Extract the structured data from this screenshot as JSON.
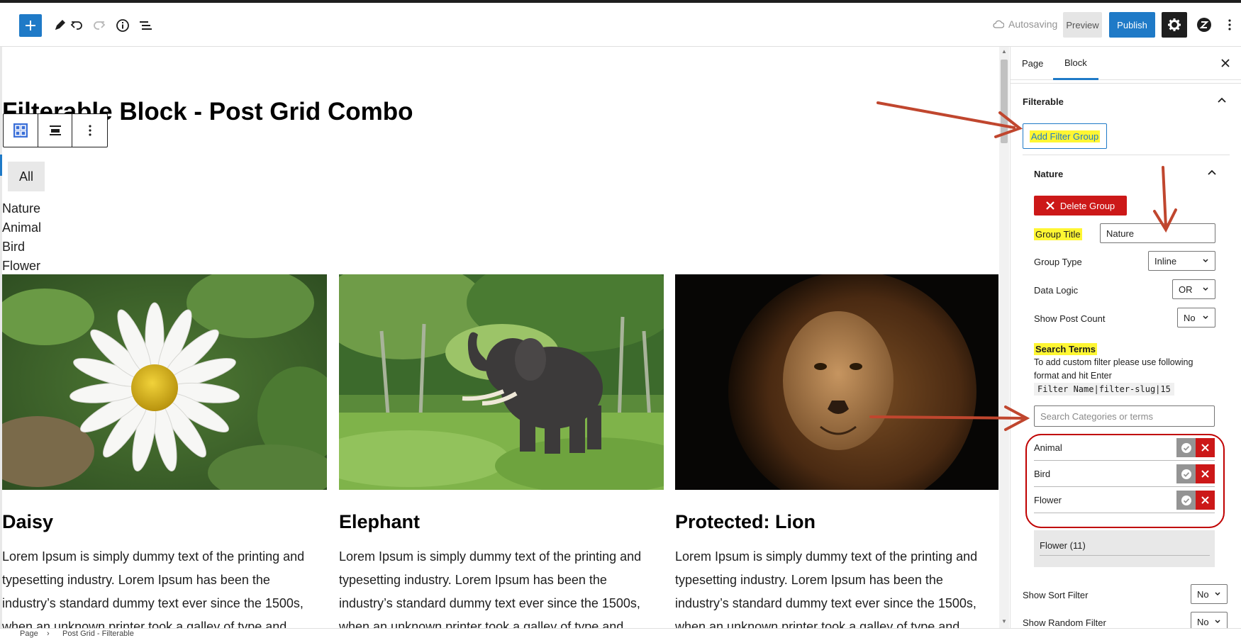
{
  "toolbar": {
    "autosave_label": "Autosaving",
    "preview_label": "Preview",
    "publish_label": "Publish"
  },
  "editor": {
    "page_title": "Filterable Block - Post Grid Combo",
    "filter_all_label": "All",
    "filter_items": [
      "Nature",
      "Animal",
      "Bird",
      "Flower"
    ],
    "posts": [
      {
        "title": "Daisy",
        "excerpt": "Lorem Ipsum is simply dummy text of the printing and typesetting industry. Lorem Ipsum has been the industry’s standard dummy text ever since the 1500s, when an unknown printer took a galley of type and"
      },
      {
        "title": "Elephant",
        "excerpt": "Lorem Ipsum is simply dummy text of the printing and typesetting industry. Lorem Ipsum has been the industry’s standard dummy text ever since the 1500s, when an unknown printer took a galley of type and"
      },
      {
        "title": "Protected: Lion",
        "excerpt": "Lorem Ipsum is simply dummy text of the printing and typesetting industry. Lorem Ipsum has been the industry’s standard dummy text ever since the 1500s, when an unknown printer took a galley of type and"
      }
    ]
  },
  "sidebar": {
    "tabs": [
      {
        "label": "Page"
      },
      {
        "label": "Block"
      }
    ],
    "active_tab": "Block",
    "panel_title": "Filterable",
    "add_filter_group_label": "Add Filter Group",
    "group": {
      "name": "Nature",
      "delete_label": "Delete Group",
      "title_label": "Group Title",
      "title_value": "Nature",
      "type_label": "Group Type",
      "type_value": "Inline",
      "logic_label": "Data Logic",
      "logic_value": "OR",
      "post_count_label": "Show Post Count",
      "post_count_value": "No",
      "search_terms_label": "Search Terms",
      "help_text": "To add custom filter please use following format and hit Enter",
      "code_format": "Filter Name|filter-slug|15",
      "search_placeholder": "Search Categories or terms",
      "terms": [
        {
          "label": "Animal"
        },
        {
          "label": "Bird"
        },
        {
          "label": "Flower"
        }
      ],
      "suggestion": "Flower (11)"
    },
    "sort_filter_label": "Show Sort Filter",
    "sort_filter_value": "No",
    "random_filter_label": "Show Random Filter",
    "random_filter_value": "No"
  },
  "breadcrumb": [
    "Page",
    "Post Grid - Filterable"
  ],
  "colors": {
    "accent": "#1f7ac7",
    "danger": "#cc1818",
    "highlight": "#fff633",
    "annotation_arrow": "#c0462e"
  }
}
